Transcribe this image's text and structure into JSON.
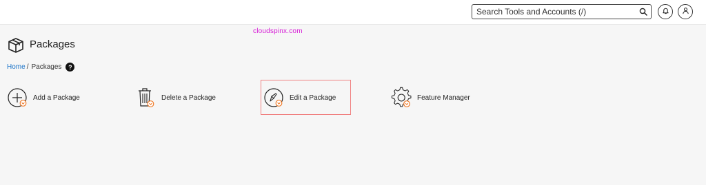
{
  "header": {
    "search": {
      "placeholder": "Search Tools and Accounts (/)",
      "value": ""
    },
    "icons": [
      "search-icon",
      "bell-icon",
      "user-icon"
    ]
  },
  "watermark": "cloudspinx.com",
  "page": {
    "title": "Packages",
    "title_icon": "box-icon"
  },
  "breadcrumb": {
    "home": "Home",
    "separator": "/",
    "current": "Packages",
    "help_icon": "question-icon"
  },
  "tools": [
    {
      "label": "Add a Package",
      "icon": "plus-circle-icon"
    },
    {
      "label": "Delete a Package",
      "icon": "trash-icon"
    },
    {
      "label": "Edit a Package",
      "icon": "edit-pen-icon",
      "highlighted": true
    },
    {
      "label": "Feature Manager",
      "icon": "gear-icon"
    }
  ],
  "colors": {
    "accent_orange": "#f07a28",
    "link_blue": "#1a73c8",
    "highlight_border": "#f08080",
    "watermark": "#d61ad6"
  }
}
